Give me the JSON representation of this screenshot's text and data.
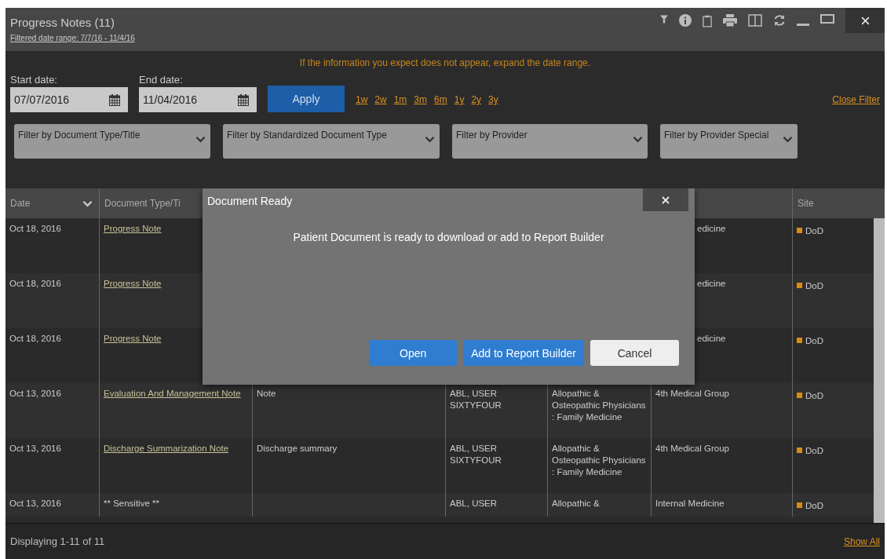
{
  "window": {
    "title": "Progress Notes (11)",
    "filter_summary": "Filtered date range: 7/7/16 - 11/4/16"
  },
  "notice": "If the information you expect does not appear, expand the date range.",
  "date_filter": {
    "start_label": "Start date:",
    "start_value": "07/07/2016",
    "end_label": "End date:",
    "end_value": "11/04/2016",
    "apply": "Apply",
    "quick_ranges": [
      "1w",
      "2w",
      "1m",
      "3m",
      "6m",
      "1y",
      "2y",
      "3y"
    ],
    "close_filter": "Close Filter"
  },
  "dropdowns": [
    "Filter by Document Type/Title",
    "Filter by Standardized Document Type",
    "Filter by Provider",
    "Filter by Provider Special"
  ],
  "table": {
    "columns": [
      "Date",
      "Document Type/Ti",
      "",
      "",
      "",
      "",
      "Site"
    ],
    "rows": [
      {
        "cells": [
          "Oct 18, 2016",
          "Progress Note",
          "",
          "",
          "",
          "edicine",
          "DoD"
        ]
      },
      {
        "cells": [
          "Oct 18, 2016",
          "Progress Note",
          "",
          "",
          "",
          "edicine",
          "DoD"
        ]
      },
      {
        "cells": [
          "Oct 18, 2016",
          "Progress Note",
          "",
          "",
          "",
          "edicine",
          "DoD"
        ]
      },
      {
        "cells": [
          "Oct 13, 2016",
          "Evaluation And Management Note",
          "Note",
          "ABL, USER SIXTYFOUR",
          "Allopathic & Osteopathic Physicians : Family Medicine",
          "4th Medical Group",
          "DoD"
        ]
      },
      {
        "cells": [
          "Oct 13, 2016",
          "Discharge Summarization Note",
          "Discharge summary",
          "ABL, USER SIXTYFOUR",
          "Allopathic & Osteopathic Physicians : Family Medicine",
          "4th Medical Group",
          "DoD"
        ]
      },
      {
        "cells": [
          "Oct 13, 2016",
          "** Sensitive **",
          "",
          "ABL, USER",
          "Allopathic &",
          "Internal Medicine",
          "DoD"
        ]
      }
    ]
  },
  "footer": {
    "count": "Displaying 1-11 of 11",
    "show_all": "Show All"
  },
  "dialog": {
    "title": "Document Ready",
    "message": "Patient Document is ready to download or add to Report Builder",
    "buttons": [
      {
        "label": "Open",
        "kind": "primary"
      },
      {
        "label": "Add to Report Builder",
        "kind": "primary"
      },
      {
        "label": "Cancel",
        "kind": "secondary"
      }
    ]
  }
}
